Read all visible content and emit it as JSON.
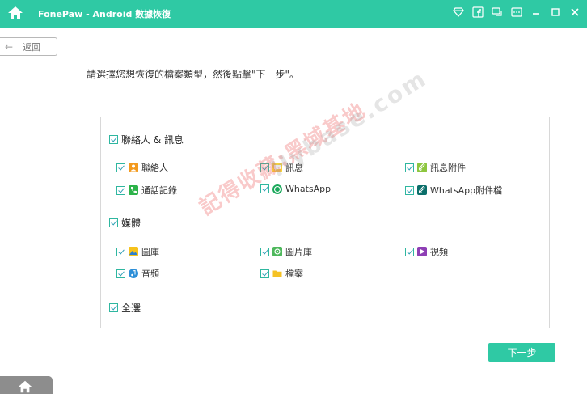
{
  "app": {
    "title": "FonePaw - Android 數據恢復"
  },
  "toolbar": {
    "icons": [
      "diamond-icon",
      "facebook-icon",
      "chat-icon",
      "menu-icon",
      "minimize-icon",
      "maximize-icon",
      "close-icon"
    ]
  },
  "back": {
    "label": "返回"
  },
  "instruction": "請選擇您想恢復的檔案類型，然後點擊\"下一步\"。",
  "groups": {
    "contacts": {
      "label": "聯絡人 & 訊息",
      "items": [
        {
          "label": "聯絡人",
          "icon": "contacts-icon"
        },
        {
          "label": "訊息",
          "icon": "messages-icon"
        },
        {
          "label": "訊息附件",
          "icon": "attachment-icon"
        },
        {
          "label": "通話記錄",
          "icon": "call-log-icon"
        },
        {
          "label": "WhatsApp",
          "icon": "whatsapp-icon"
        },
        {
          "label": "WhatsApp附件檔",
          "icon": "whatsapp-attachment-icon"
        }
      ]
    },
    "media": {
      "label": "媒體",
      "items": [
        {
          "label": "圖庫",
          "icon": "gallery-icon"
        },
        {
          "label": "圖片庫",
          "icon": "picture-library-icon"
        },
        {
          "label": "視頻",
          "icon": "video-icon"
        },
        {
          "label": "音頻",
          "icon": "audio-icon"
        },
        {
          "label": "檔案",
          "icon": "folder-icon"
        }
      ]
    }
  },
  "select_all": {
    "label": "全選"
  },
  "watermark": {
    "line1": "記得收藏:黑域基地",
    "line2": "Hybase.com"
  },
  "next": {
    "label": "下一步"
  },
  "colors": {
    "accent": "#2fc9a4",
    "check": "#2f9fb7"
  }
}
